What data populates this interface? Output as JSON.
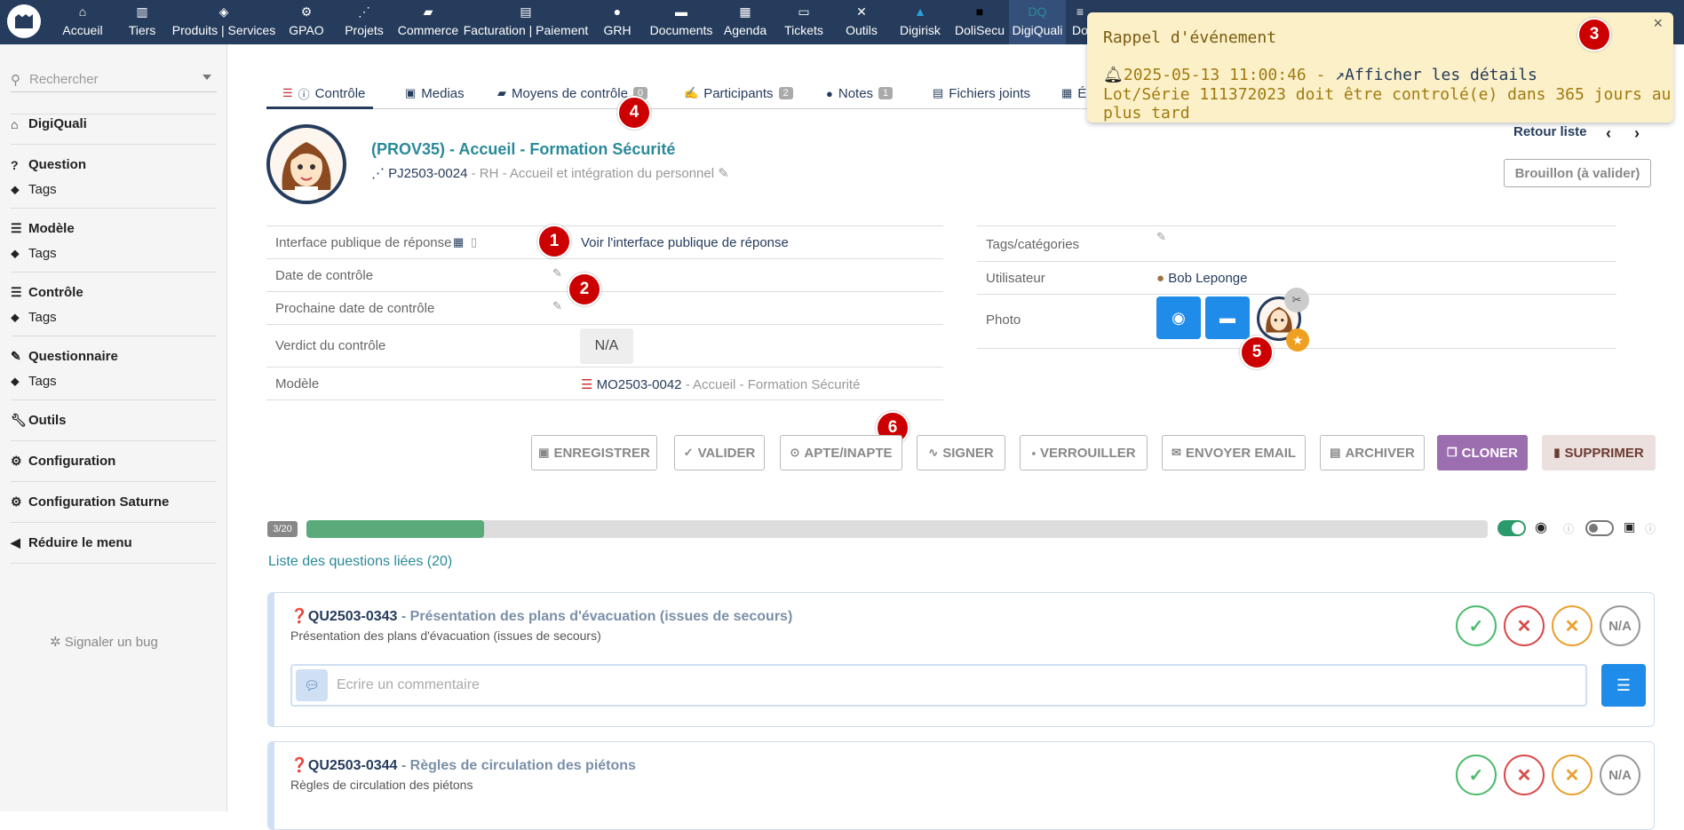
{
  "topnav": {
    "items": [
      {
        "label": "Accueil",
        "icon": "home-icon"
      },
      {
        "label": "Tiers",
        "icon": "building-icon"
      },
      {
        "label": "Produits | Services",
        "icon": "cube-icon"
      },
      {
        "label": "GPAO",
        "icon": "cogs-icon"
      },
      {
        "label": "Projets",
        "icon": "project-icon"
      },
      {
        "label": "Commerce",
        "icon": "briefcase-icon"
      },
      {
        "label": "Facturation | Paiement",
        "icon": "invoice-icon"
      },
      {
        "label": "GRH",
        "icon": "user-icon"
      },
      {
        "label": "Documents",
        "icon": "folder-icon"
      },
      {
        "label": "Agenda",
        "icon": "calendar-icon"
      },
      {
        "label": "Tickets",
        "icon": "ticket-icon"
      },
      {
        "label": "Outils",
        "icon": "tools-icon"
      },
      {
        "label": "Digirisk",
        "icon": "digirisk-icon"
      },
      {
        "label": "DoliSecu",
        "icon": "lock-icon"
      },
      {
        "label": "DigiQuali",
        "icon": "digiquali-icon"
      },
      {
        "label": "Do",
        "icon": "list-icon"
      }
    ]
  },
  "sidebar": {
    "search_placeholder": "Rechercher",
    "items": [
      {
        "label": "DigiQuali",
        "type": "main",
        "icon": "home-icon"
      },
      {
        "label": "Question",
        "type": "main",
        "icon": "question-icon"
      },
      {
        "label": "Tags",
        "type": "sub",
        "icon": "tags-icon"
      },
      {
        "label": "Modèle",
        "type": "main",
        "icon": "list-icon"
      },
      {
        "label": "Tags",
        "type": "sub",
        "icon": "tags-icon"
      },
      {
        "label": "Contrôle",
        "type": "main",
        "icon": "list-icon"
      },
      {
        "label": "Tags",
        "type": "sub",
        "icon": "tags-icon"
      },
      {
        "label": "Questionnaire",
        "type": "main",
        "icon": "pen-icon"
      },
      {
        "label": "Tags",
        "type": "sub",
        "icon": "tags-icon"
      },
      {
        "label": "Outils",
        "type": "main",
        "icon": "wrench-icon"
      },
      {
        "label": "Configuration",
        "type": "main",
        "icon": "gear-icon"
      },
      {
        "label": "Configuration Saturne",
        "type": "main",
        "icon": "gear-icon"
      },
      {
        "label": "Réduire le menu",
        "type": "main",
        "icon": "arrow-left-icon"
      }
    ],
    "bug_label": "Signaler un bug"
  },
  "tabs": [
    {
      "label": "Contrôle",
      "badge": null
    },
    {
      "label": "Medias",
      "badge": null
    },
    {
      "label": "Moyens de contrôle",
      "badge": "0"
    },
    {
      "label": "Participants",
      "badge": "2"
    },
    {
      "label": "Notes",
      "badge": "1"
    },
    {
      "label": "Fichiers joints",
      "badge": null
    },
    {
      "label": "É",
      "badge": null
    }
  ],
  "header": {
    "title": "(PROV35) - Accueil - Formation Sécurité",
    "project_ref": "PJ2503-0024",
    "project_desc": " - RH - Accueil et intégration du personnel",
    "retour": "Retour liste",
    "status": "Brouillon (à valider)"
  },
  "fields_left": [
    {
      "label": "Interface publique de réponse",
      "value": "Voir l'interface publique de réponse"
    },
    {
      "label": "Date de contrôle",
      "value": ""
    },
    {
      "label": "Prochaine date de contrôle",
      "value": ""
    },
    {
      "label": "Verdict du contrôle",
      "value": "N/A"
    },
    {
      "label": "Modèle",
      "ref": "MO2503-0042",
      "desc": " - Accueil - Formation Sécurité"
    }
  ],
  "fields_right": [
    {
      "label": "Tags/catégories",
      "value": ""
    },
    {
      "label": "Utilisateur",
      "value": "Bob Leponge"
    },
    {
      "label": "Photo",
      "value": ""
    }
  ],
  "markers": [
    "1",
    "2",
    "3",
    "4",
    "5",
    "6"
  ],
  "buttons": [
    {
      "label": "ENREGISTRER"
    },
    {
      "label": "VALIDER"
    },
    {
      "label": "APTE/INAPTE"
    },
    {
      "label": "SIGNER"
    },
    {
      "label": "VERROUILLER"
    },
    {
      "label": "ENVOYER EMAIL"
    },
    {
      "label": "ARCHIVER"
    },
    {
      "label": "CLONER"
    },
    {
      "label": "SUPPRIMER"
    }
  ],
  "progress": {
    "count": "3/20",
    "fraction": 0.15
  },
  "linked_questions_title": "Liste des questions liées (20)",
  "questions": [
    {
      "ref": "QU2503-0343",
      "title": " - Présentation des plans d'évacuation (issues de secours)",
      "desc": "Présentation des plans d'évacuation (issues de secours)",
      "comment_placeholder": "Ecrire un commentaire"
    },
    {
      "ref": "QU2503-0344",
      "title": " - Règles de circulation des piétons",
      "desc": "Règles de circulation des piétons"
    }
  ],
  "answer_na": "N/A",
  "popup": {
    "title": "Rappel d'événement",
    "datetime": "2025-05-13 11:00:46 - ",
    "link": "Afficher les détails",
    "message": "Lot/Série 111372023 doit être controlé(e) dans 365 jours au plus tard"
  },
  "colors": {
    "navbar": "#263c5c",
    "accent": "#2a8a98",
    "progress": "#5aaa7a",
    "marker": "#cc0000",
    "clone": "#9c6eb0",
    "popup_bg": "#fbf0c8"
  }
}
